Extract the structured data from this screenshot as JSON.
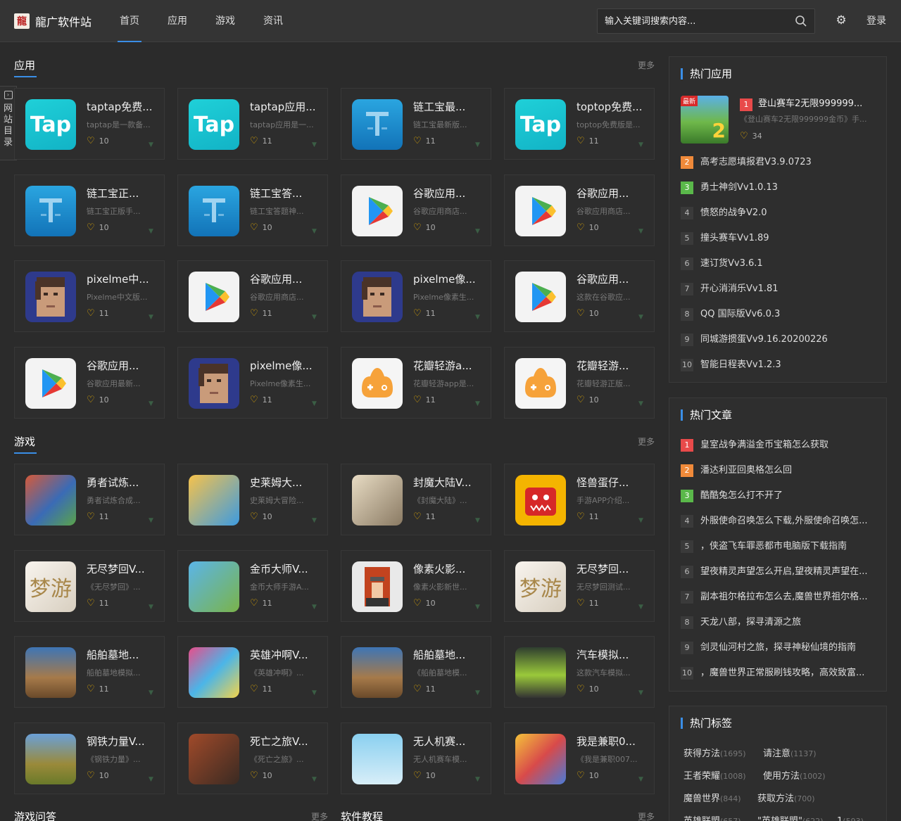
{
  "header": {
    "logo_mark": "龍",
    "site_name": "龍广软件站",
    "nav": [
      "首页",
      "应用",
      "游戏",
      "资讯"
    ],
    "search_placeholder": "输入关键词搜索内容...",
    "login": "登录"
  },
  "side_tab": {
    "label": "网站目录"
  },
  "apps_section": {
    "title": "应用",
    "more": "更多",
    "items": [
      {
        "title": "taptap免费...",
        "desc": "taptap是一款备...",
        "likes": "10",
        "icon": "tap"
      },
      {
        "title": "taptap应用...",
        "desc": "taptap应用是一...",
        "likes": "11",
        "icon": "tap"
      },
      {
        "title": "链工宝最...",
        "desc": "链工宝最新版...",
        "likes": "11",
        "icon": "chain"
      },
      {
        "title": "toptop免费...",
        "desc": "toptop免费版是...",
        "likes": "11",
        "icon": "tap"
      },
      {
        "title": "链工宝正...",
        "desc": "链工宝正版手...",
        "likes": "10",
        "icon": "chain"
      },
      {
        "title": "链工宝答...",
        "desc": "链工宝答题神...",
        "likes": "10",
        "icon": "chain"
      },
      {
        "title": "谷歌应用...",
        "desc": "谷歌应用商店...",
        "likes": "10",
        "icon": "gplay"
      },
      {
        "title": "谷歌应用...",
        "desc": "谷歌应用商店...",
        "likes": "10",
        "icon": "gplay"
      },
      {
        "title": "pixelme中...",
        "desc": "Pixelme中文版...",
        "likes": "11",
        "icon": "pix"
      },
      {
        "title": "谷歌应用...",
        "desc": "谷歌应用商店...",
        "likes": "11",
        "icon": "gplay"
      },
      {
        "title": "pixelme像...",
        "desc": "Pixelme像素生...",
        "likes": "11",
        "icon": "pix"
      },
      {
        "title": "谷歌应用...",
        "desc": "这款在谷歌应...",
        "likes": "10",
        "icon": "gplay"
      },
      {
        "title": "谷歌应用...",
        "desc": "谷歌应用最新...",
        "likes": "10",
        "icon": "gplay"
      },
      {
        "title": "pixelme像...",
        "desc": "Pixelme像素生...",
        "likes": "11",
        "icon": "pix"
      },
      {
        "title": "花瓣轻游a...",
        "desc": "花瓣轻游app是...",
        "likes": "11",
        "icon": "flower"
      },
      {
        "title": "花瓣轻游...",
        "desc": "花瓣轻游正版...",
        "likes": "10",
        "icon": "flower"
      }
    ]
  },
  "games_section": {
    "title": "游戏",
    "more": "更多",
    "items": [
      {
        "title": "勇者试炼...",
        "desc": "勇者试炼合成...",
        "likes": "11",
        "icon": "brave"
      },
      {
        "title": "史莱姆大...",
        "desc": "史莱姆大冒险...",
        "likes": "10",
        "icon": "slime"
      },
      {
        "title": "封魔大陆V...",
        "desc": "《封魔大陆》...",
        "likes": "11",
        "icon": "fmd"
      },
      {
        "title": "怪兽蛋仔...",
        "desc": "手游APP介绍...",
        "likes": "11",
        "icon": "monster"
      },
      {
        "title": "无尽梦回V...",
        "desc": "《无尽梦回》...",
        "likes": "11",
        "icon": "dream"
      },
      {
        "title": "金币大师V...",
        "desc": "金币大师手游A...",
        "likes": "11",
        "icon": "coin"
      },
      {
        "title": "像素火影...",
        "desc": "像素火影新世...",
        "likes": "10",
        "icon": "pixel"
      },
      {
        "title": "无尽梦回...",
        "desc": "无尽梦回测试...",
        "likes": "11",
        "icon": "dream"
      },
      {
        "title": "船舶墓地...",
        "desc": "船舶墓地模拟...",
        "likes": "11",
        "icon": "ship"
      },
      {
        "title": "英雄冲啊V...",
        "desc": "《英雄冲啊》...",
        "likes": "11",
        "icon": "hero"
      },
      {
        "title": "船舶墓地...",
        "desc": "《船舶墓地模...",
        "likes": "11",
        "icon": "ship"
      },
      {
        "title": "汽车模拟...",
        "desc": "这款汽车模拟...",
        "likes": "10",
        "icon": "car"
      },
      {
        "title": "钢铁力量V...",
        "desc": "《钢铁力量》...",
        "likes": "10",
        "icon": "tank"
      },
      {
        "title": "死亡之旅V...",
        "desc": "《死亡之旅》...",
        "likes": "10",
        "icon": "dead"
      },
      {
        "title": "无人机赛...",
        "desc": "无人机赛车模...",
        "likes": "10",
        "icon": "drone"
      },
      {
        "title": "我是兼职0...",
        "desc": "《我是兼职007...",
        "likes": "10",
        "icon": "part"
      }
    ]
  },
  "bottom_sections": [
    {
      "title": "游戏问答",
      "more": "更多"
    },
    {
      "title": "软件教程",
      "more": "更多"
    }
  ],
  "hot_apps": {
    "title": "热门应用",
    "featured": {
      "rank": "1",
      "title": "登山赛车2无限999999...",
      "desc": "《登山赛车2无限999999金币》手...",
      "likes": "34",
      "badge": "最新",
      "badge_num": "2"
    },
    "items": [
      {
        "rank": "2",
        "title": "高考志愿填报君V3.9.0723"
      },
      {
        "rank": "3",
        "title": "勇士神剑Vv1.0.13"
      },
      {
        "rank": "4",
        "title": "愤怒的战争V2.0"
      },
      {
        "rank": "5",
        "title": "撞头赛车Vv1.89"
      },
      {
        "rank": "6",
        "title": "速订货Vv3.6.1"
      },
      {
        "rank": "7",
        "title": "开心消消乐Vv1.81"
      },
      {
        "rank": "8",
        "title": "QQ 国际版Vv6.0.3"
      },
      {
        "rank": "9",
        "title": "同城游掼蛋Vv9.16.20200226"
      },
      {
        "rank": "10",
        "title": "智能日程表Vv1.2.3"
      }
    ]
  },
  "hot_articles": {
    "title": "热门文章",
    "items": [
      {
        "rank": "1",
        "title": "皇室战争满溢金币宝箱怎么获取"
      },
      {
        "rank": "2",
        "title": "潘达利亚回奥格怎么回"
      },
      {
        "rank": "3",
        "title": "酷酷兔怎么打不开了"
      },
      {
        "rank": "4",
        "title": "外服使命召唤怎么下载,外服使命召唤怎..."
      },
      {
        "rank": "5",
        "title": "，侠盗飞车罪恶都市电脑版下载指南"
      },
      {
        "rank": "6",
        "title": "望夜精灵声望怎么开启,望夜精灵声望在..."
      },
      {
        "rank": "7",
        "title": "副本祖尔格拉布怎么去,魔兽世界祖尔格..."
      },
      {
        "rank": "8",
        "title": "天龙八部，探寻清源之旅"
      },
      {
        "rank": "9",
        "title": "剑灵仙河村之旅，探寻神秘仙境的指南"
      },
      {
        "rank": "10",
        "title": "，魔兽世界正常服刷钱攻略，高效致富..."
      }
    ]
  },
  "hot_tags": {
    "title": "热门标签",
    "items": [
      {
        "name": "获得方法",
        "count": "(1695)"
      },
      {
        "name": "请注意",
        "count": "(1137)"
      },
      {
        "name": "王者荣耀",
        "count": "(1008)"
      },
      {
        "name": "使用方法",
        "count": "(1002)"
      },
      {
        "name": "魔兽世界",
        "count": "(844)"
      },
      {
        "name": "获取方法",
        "count": "(700)"
      },
      {
        "name": "英雄联盟",
        "count": "(657)"
      },
      {
        "name": "\"英雄联盟\"",
        "count": "(622)"
      },
      {
        "name": "1",
        "count": "(593)"
      }
    ]
  },
  "colors": {
    "accent": "#3a8ee6",
    "background": "#2b2b2b",
    "rank1": "#e84a4a",
    "rank2": "#f08a3a",
    "rank3": "#5ab84a",
    "heart": "#f0b400"
  }
}
